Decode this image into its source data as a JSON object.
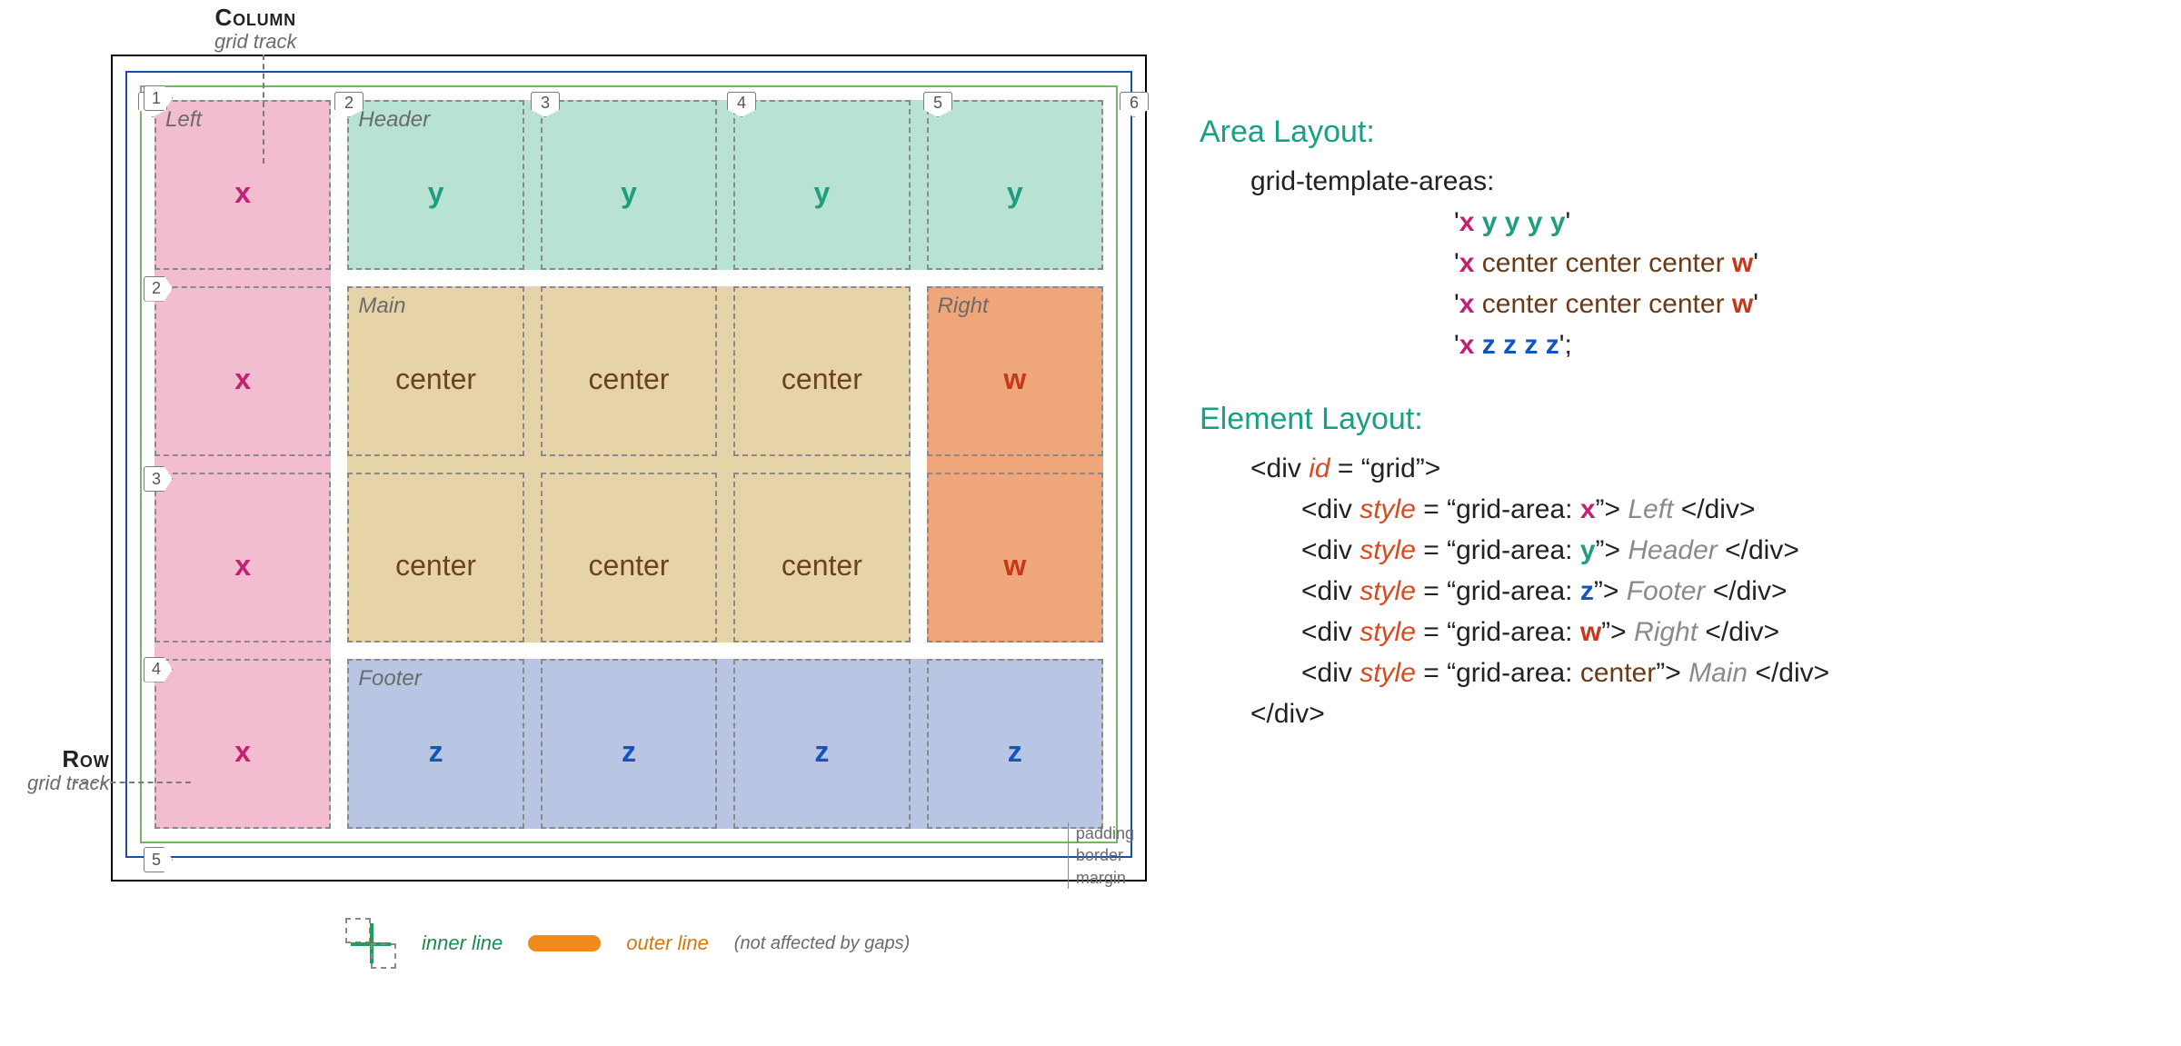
{
  "axis": {
    "column": {
      "caption": "Column",
      "track": "grid track"
    },
    "row": {
      "caption": "Row",
      "track": "grid track"
    }
  },
  "grid": {
    "column_lines": [
      "1",
      "2",
      "3",
      "4",
      "5",
      "6"
    ],
    "row_lines": [
      "1",
      "2",
      "3",
      "4",
      "5"
    ],
    "template_areas_source": "'x y y y y' 'x center center center w' 'x center center center w' 'x z z z z';",
    "areas": {
      "x": {
        "label": "Left",
        "color": "#f3bdd1"
      },
      "y": {
        "label": "Header",
        "color": "#b8e2d1"
      },
      "center": {
        "label": "Main",
        "color": "#e7d3a8"
      },
      "w": {
        "label": "Right",
        "color": "#efa67a"
      },
      "z": {
        "label": "Footer",
        "color": "#b8c5e3"
      }
    },
    "template": [
      [
        "x",
        "y",
        "y",
        "y",
        "y"
      ],
      [
        "x",
        "center",
        "center",
        "center",
        "w"
      ],
      [
        "x",
        "center",
        "center",
        "center",
        "w"
      ],
      [
        "x",
        "z",
        "z",
        "z",
        "z"
      ]
    ],
    "cell_letters": {
      "x": "x",
      "y": "y",
      "center": "center",
      "w": "w",
      "z": "z"
    }
  },
  "dims": {
    "padding": "padding",
    "border": "border",
    "margin": "margin"
  },
  "legend": {
    "inner": "inner line",
    "outer": "outer line",
    "outer_note": "(not affected by gaps)"
  },
  "right": {
    "area_title": "Area Layout:",
    "gta": "grid-template-areas:",
    "rows": [
      [
        {
          "t": "'",
          "c": "plain"
        },
        {
          "t": "x",
          "c": "x"
        },
        {
          "t": " ",
          "c": "plain"
        },
        {
          "t": "y y y y",
          "c": "y"
        },
        {
          "t": "'",
          "c": "plain"
        }
      ],
      [
        {
          "t": "'",
          "c": "plain"
        },
        {
          "t": "x",
          "c": "x"
        },
        {
          "t": " center center center ",
          "c": "center"
        },
        {
          "t": "w",
          "c": "w"
        },
        {
          "t": "'",
          "c": "plain"
        }
      ],
      [
        {
          "t": "'",
          "c": "plain"
        },
        {
          "t": "x",
          "c": "x"
        },
        {
          "t": " center center center ",
          "c": "center"
        },
        {
          "t": "w",
          "c": "w"
        },
        {
          "t": "'",
          "c": "plain"
        }
      ],
      [
        {
          "t": "'",
          "c": "plain"
        },
        {
          "t": "x",
          "c": "x"
        },
        {
          "t": " ",
          "c": "plain"
        },
        {
          "t": "z z z z",
          "c": "z"
        },
        {
          "t": "';",
          "c": "plain"
        }
      ]
    ],
    "element_title": "Element Layout:",
    "html_lines": [
      {
        "indent": "indent-div",
        "parts": [
          {
            "t": "<div ",
            "c": "plain"
          },
          {
            "t": "id",
            "c": "attr"
          },
          {
            "t": " = “grid”>",
            "c": "plain"
          }
        ]
      },
      {
        "indent": "indent-child",
        "parts": [
          {
            "t": "<div ",
            "c": "plain"
          },
          {
            "t": "style",
            "c": "attr"
          },
          {
            "t": " = “grid-area: ",
            "c": "plain"
          },
          {
            "t": "x",
            "c": "x"
          },
          {
            "t": "”> ",
            "c": "plain"
          },
          {
            "t": "Left",
            "c": "gray"
          },
          {
            "t": " </div>",
            "c": "plain"
          }
        ]
      },
      {
        "indent": "indent-child",
        "parts": [
          {
            "t": "<div ",
            "c": "plain"
          },
          {
            "t": "style",
            "c": "attr"
          },
          {
            "t": " = “grid-area: ",
            "c": "plain"
          },
          {
            "t": "y",
            "c": "y"
          },
          {
            "t": "”> ",
            "c": "plain"
          },
          {
            "t": "Header",
            "c": "gray"
          },
          {
            "t": " </div>",
            "c": "plain"
          }
        ]
      },
      {
        "indent": "indent-child",
        "parts": [
          {
            "t": "<div ",
            "c": "plain"
          },
          {
            "t": "style",
            "c": "attr"
          },
          {
            "t": " = “grid-area: ",
            "c": "plain"
          },
          {
            "t": "z",
            "c": "z"
          },
          {
            "t": "”> ",
            "c": "plain"
          },
          {
            "t": "Footer",
            "c": "gray"
          },
          {
            "t": " </div>",
            "c": "plain"
          }
        ]
      },
      {
        "indent": "indent-child",
        "parts": [
          {
            "t": "<div ",
            "c": "plain"
          },
          {
            "t": "style",
            "c": "attr"
          },
          {
            "t": " = “grid-area: ",
            "c": "plain"
          },
          {
            "t": "w",
            "c": "w"
          },
          {
            "t": "”> ",
            "c": "plain"
          },
          {
            "t": "Right",
            "c": "gray"
          },
          {
            "t": " </div>",
            "c": "plain"
          }
        ]
      },
      {
        "indent": "indent-child",
        "parts": [
          {
            "t": "<div ",
            "c": "plain"
          },
          {
            "t": "style",
            "c": "attr"
          },
          {
            "t": " = “grid-area: ",
            "c": "plain"
          },
          {
            "t": "center",
            "c": "center"
          },
          {
            "t": "”> ",
            "c": "plain"
          },
          {
            "t": "Main",
            "c": "gray"
          },
          {
            "t": " </div>",
            "c": "plain"
          }
        ]
      },
      {
        "indent": "indent-div",
        "parts": [
          {
            "t": "</div>",
            "c": "plain"
          }
        ]
      }
    ]
  }
}
